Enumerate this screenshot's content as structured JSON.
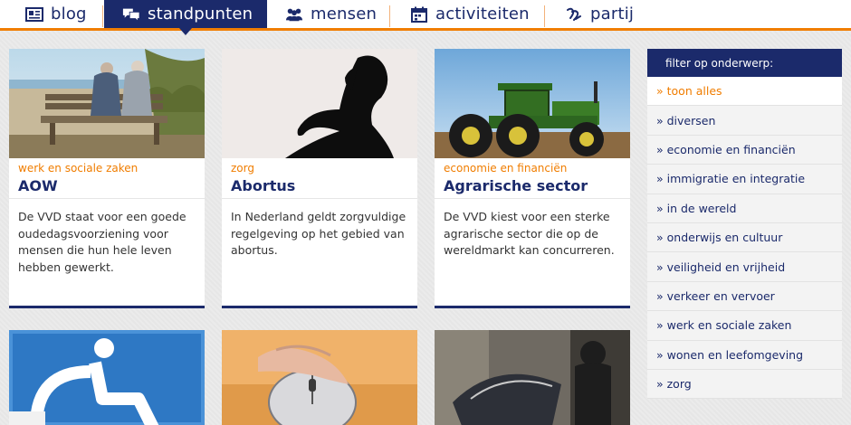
{
  "nav": {
    "items": [
      {
        "label": "blog",
        "icon": "blog-icon"
      },
      {
        "label": "standpunten",
        "icon": "speech-bubbles-icon",
        "active": true
      },
      {
        "label": "mensen",
        "icon": "people-icon"
      },
      {
        "label": "activiteiten",
        "icon": "calendar-icon"
      },
      {
        "label": "partij",
        "icon": "signature-icon"
      }
    ]
  },
  "cards": [
    {
      "category": "werk en sociale zaken",
      "title": "AOW",
      "description": "De VVD staat voor een goede oudedagsvoorziening voor mensen die hun hele leven hebben gewerkt."
    },
    {
      "category": "zorg",
      "title": "Abortus",
      "description": "In Nederland geldt zorgvuldige regelgeving op het gebied van abortus."
    },
    {
      "category": "economie en financiën",
      "title": "Agrarische sector",
      "description": "De VVD kiest voor een sterke agrarische sector die op de wereldmarkt kan concurreren."
    }
  ],
  "sidebar": {
    "heading": "filter op onderwerp:",
    "items": [
      "» toon alles",
      "» diversen",
      "» economie en financiën",
      "» immigratie en integratie",
      "» in de wereld",
      "» onderwijs en cultuur",
      "» veiligheid en vrijheid",
      "» verkeer en vervoer",
      "» werk en sociale zaken",
      "» wonen en leefomgeving",
      "» zorg"
    ]
  },
  "colors": {
    "brand_navy": "#1b2a6b",
    "accent_orange": "#f07d00"
  }
}
